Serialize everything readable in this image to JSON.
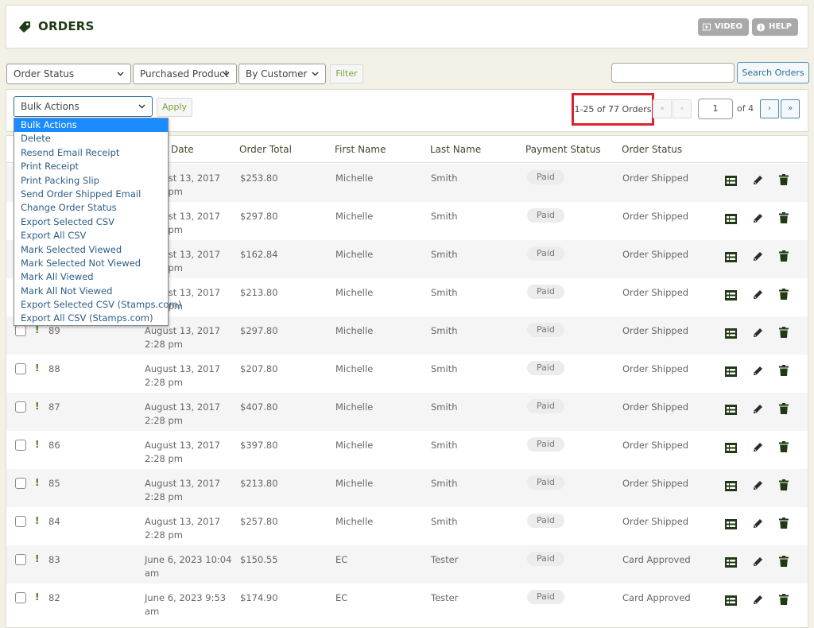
{
  "header": {
    "title": "ORDERS",
    "video_label": "VIDEO",
    "help_label": "HELP"
  },
  "filters": {
    "order_status": "Order Status",
    "purchased_product": "Purchased Product",
    "by_customer": "By Customer",
    "filter_label": "Filter",
    "search_value": "",
    "search_label": "Search Orders"
  },
  "bulk": {
    "selected": "Bulk Actions",
    "apply_label": "Apply",
    "options": [
      "Bulk Actions",
      "Delete",
      "Resend Email Receipt",
      "Print Receipt",
      "Print Packing Slip",
      "Send Order Shipped Email",
      "Change Order Status",
      "Export Selected CSV",
      "Export All CSV",
      "Mark Selected Viewed",
      "Mark Selected Not Viewed",
      "Mark All Viewed",
      "Mark All Not Viewed",
      "Export Selected CSV (Stamps.com)",
      "Export All CSV (Stamps.com)"
    ]
  },
  "pagination": {
    "count_label": "1-25 of 77 Orders",
    "first": "«",
    "prev": "‹",
    "current_page": "1",
    "of_label": "of 4",
    "next": "›",
    "last": "»"
  },
  "table": {
    "columns": [
      "Date",
      "Order Total",
      "First Name",
      "Last Name",
      "Payment Status",
      "Order Status"
    ],
    "rows": [
      {
        "id": "",
        "date1": "August 13, 2017",
        "date2": "2:28 pm",
        "total": "$253.80",
        "first": "Michelle",
        "last": "Smith",
        "payment": "Paid",
        "status": "Order Shipped"
      },
      {
        "id": "",
        "date1": "August 13, 2017",
        "date2": "2:28 pm",
        "total": "$297.80",
        "first": "Michelle",
        "last": "Smith",
        "payment": "Paid",
        "status": "Order Shipped"
      },
      {
        "id": "",
        "date1": "August 13, 2017",
        "date2": "2:28 pm",
        "total": "$162.84",
        "first": "Michelle",
        "last": "Smith",
        "payment": "Paid",
        "status": "Order Shipped"
      },
      {
        "id": "",
        "date1": "August 13, 2017",
        "date2": "2:28 pm",
        "total": "$213.80",
        "first": "Michelle",
        "last": "Smith",
        "payment": "Paid",
        "status": "Order Shipped"
      },
      {
        "id": "89",
        "date1": "August 13, 2017",
        "date2": "2:28 pm",
        "total": "$297.80",
        "first": "Michelle",
        "last": "Smith",
        "payment": "Paid",
        "status": "Order Shipped"
      },
      {
        "id": "88",
        "date1": "August 13, 2017",
        "date2": "2:28 pm",
        "total": "$207.80",
        "first": "Michelle",
        "last": "Smith",
        "payment": "Paid",
        "status": "Order Shipped"
      },
      {
        "id": "87",
        "date1": "August 13, 2017",
        "date2": "2:28 pm",
        "total": "$407.80",
        "first": "Michelle",
        "last": "Smith",
        "payment": "Paid",
        "status": "Order Shipped"
      },
      {
        "id": "86",
        "date1": "August 13, 2017",
        "date2": "2:28 pm",
        "total": "$397.80",
        "first": "Michelle",
        "last": "Smith",
        "payment": "Paid",
        "status": "Order Shipped"
      },
      {
        "id": "85",
        "date1": "August 13, 2017",
        "date2": "2:28 pm",
        "total": "$213.80",
        "first": "Michelle",
        "last": "Smith",
        "payment": "Paid",
        "status": "Order Shipped"
      },
      {
        "id": "84",
        "date1": "August 13, 2017",
        "date2": "2:28 pm",
        "total": "$257.80",
        "first": "Michelle",
        "last": "Smith",
        "payment": "Paid",
        "status": "Order Shipped"
      },
      {
        "id": "83",
        "date1": "June 6, 2023 10:04",
        "date2": "am",
        "total": "$150.55",
        "first": "EC",
        "last": "Tester",
        "payment": "Paid",
        "status": "Card Approved"
      },
      {
        "id": "82",
        "date1": "June 6, 2023 9:53",
        "date2": "am",
        "total": "$174.90",
        "first": "EC",
        "last": "Tester",
        "payment": "Paid",
        "status": "Card Approved"
      }
    ]
  },
  "colors": {
    "accent_green": "#1f3a14",
    "highlight_red": "#d9232e",
    "link_blue": "#2e6f98",
    "selected_blue": "#1a8cff"
  }
}
